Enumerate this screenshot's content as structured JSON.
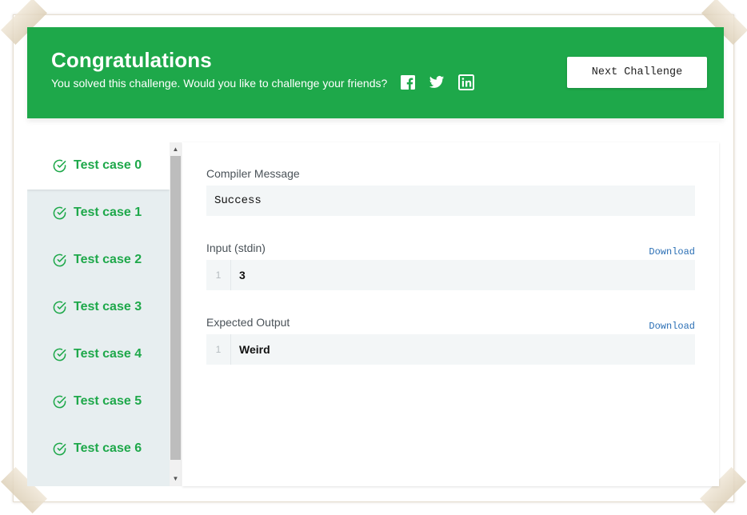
{
  "banner": {
    "title": "Congratulations",
    "subtitle": "You solved this challenge. Would you like to challenge your friends?",
    "next_button": "Next Challenge",
    "color": "#1ea84a",
    "social_icons": [
      "facebook-icon",
      "twitter-icon",
      "linkedin-icon"
    ]
  },
  "test_cases": [
    {
      "label": "Test case 0",
      "active": true
    },
    {
      "label": "Test case 1",
      "active": false
    },
    {
      "label": "Test case 2",
      "active": false
    },
    {
      "label": "Test case 3",
      "active": false
    },
    {
      "label": "Test case 4",
      "active": false
    },
    {
      "label": "Test case 5",
      "active": false
    },
    {
      "label": "Test case 6",
      "active": false
    }
  ],
  "compiler": {
    "label": "Compiler Message",
    "message": "Success"
  },
  "input": {
    "label": "Input (stdin)",
    "download": "Download",
    "line_number": "1",
    "value": "3"
  },
  "expected": {
    "label": "Expected Output",
    "download": "Download",
    "line_number": "1",
    "value": "Weird"
  }
}
